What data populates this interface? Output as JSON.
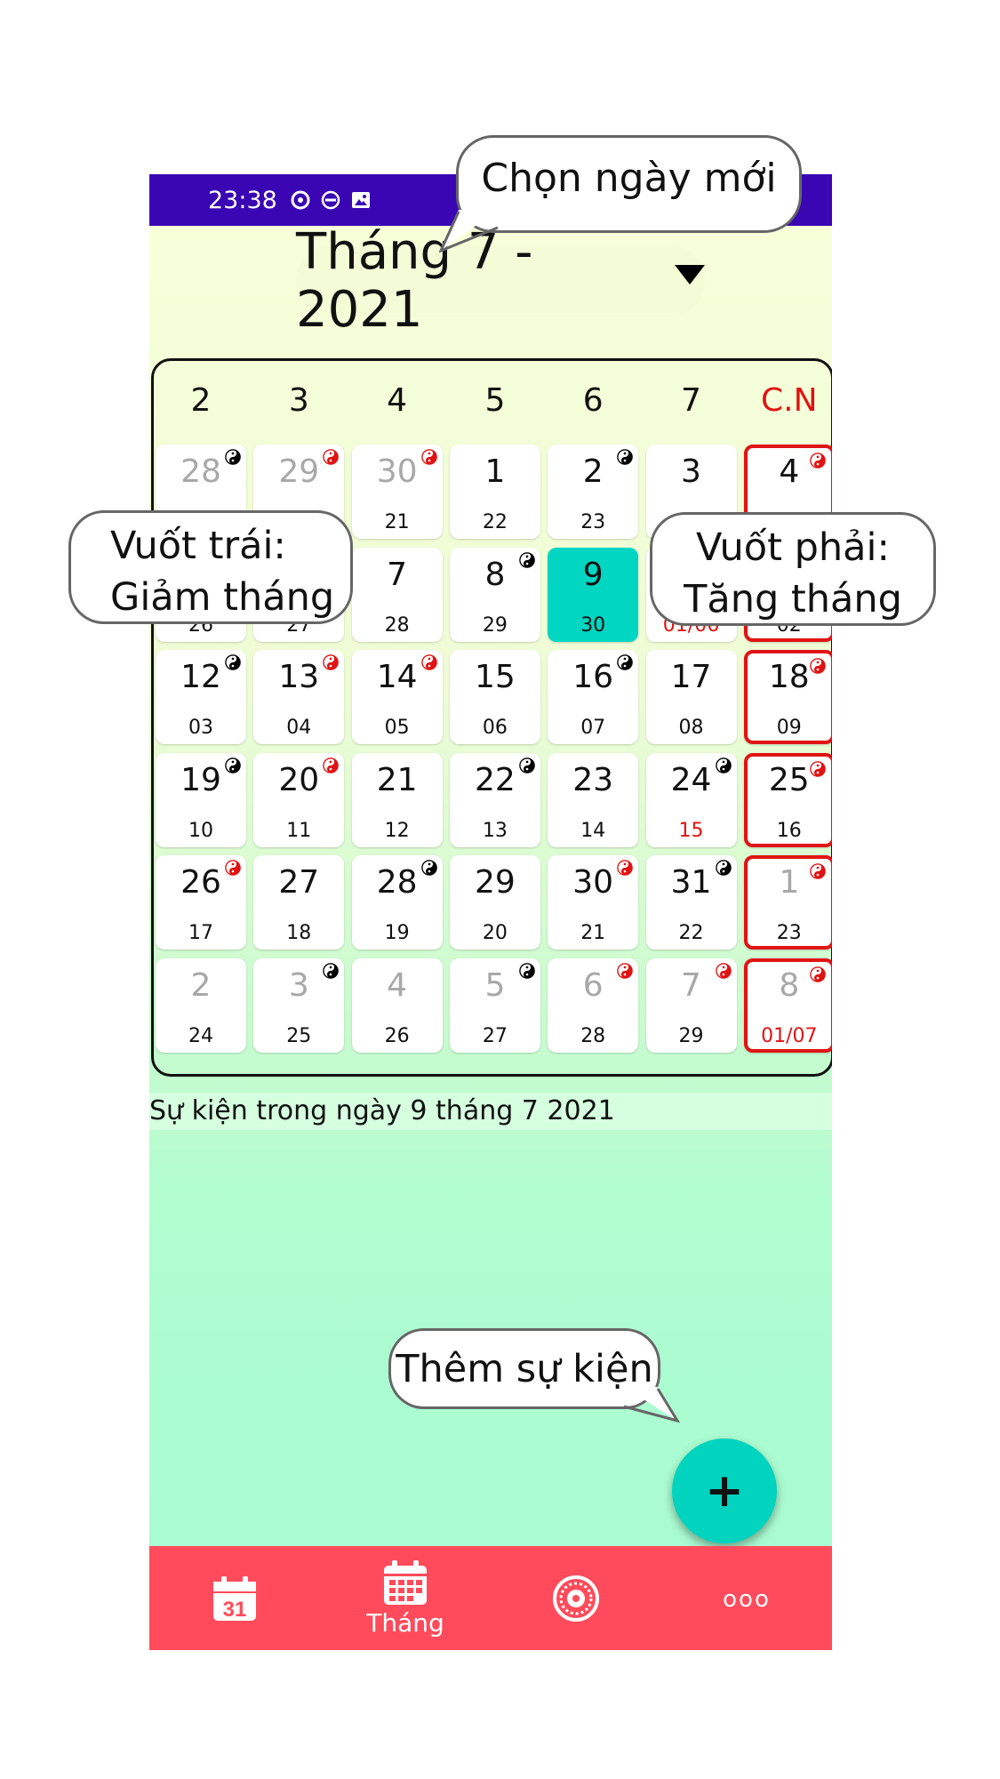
{
  "status_bar": {
    "time": "23:38"
  },
  "header": {
    "month_label": "Tháng 7 - 2021"
  },
  "weekdays": [
    "2",
    "3",
    "4",
    "5",
    "6",
    "7",
    "C.N"
  ],
  "weeks": [
    [
      {
        "d": "28",
        "l": "",
        "dim": true,
        "yy": "b"
      },
      {
        "d": "29",
        "l": "",
        "dim": true,
        "yy": "r"
      },
      {
        "d": "30",
        "l": "21",
        "dim": true,
        "yy": "r"
      },
      {
        "d": "1",
        "l": "22",
        "yy": ""
      },
      {
        "d": "2",
        "l": "23",
        "yy": "b"
      },
      {
        "d": "3",
        "l": "",
        "yy": ""
      },
      {
        "d": "4",
        "l": "",
        "yy": "r",
        "sun": true
      }
    ],
    [
      {
        "d": "",
        "l": "26",
        "yy": ""
      },
      {
        "d": "",
        "l": "27",
        "yy": ""
      },
      {
        "d": "7",
        "l": "28",
        "yy": ""
      },
      {
        "d": "8",
        "l": "29",
        "yy": "b"
      },
      {
        "d": "9",
        "l": "30",
        "yy": "",
        "selected": true
      },
      {
        "d": "",
        "l": "01/06",
        "yy": "",
        "lred": true
      },
      {
        "d": "",
        "l": "02",
        "yy": "",
        "sun": true
      }
    ],
    [
      {
        "d": "12",
        "l": "03",
        "yy": "b"
      },
      {
        "d": "13",
        "l": "04",
        "yy": "r"
      },
      {
        "d": "14",
        "l": "05",
        "yy": "r"
      },
      {
        "d": "15",
        "l": "06",
        "yy": ""
      },
      {
        "d": "16",
        "l": "07",
        "yy": "b"
      },
      {
        "d": "17",
        "l": "08",
        "yy": ""
      },
      {
        "d": "18",
        "l": "09",
        "yy": "r",
        "sun": true
      }
    ],
    [
      {
        "d": "19",
        "l": "10",
        "yy": "b"
      },
      {
        "d": "20",
        "l": "11",
        "yy": "r"
      },
      {
        "d": "21",
        "l": "12",
        "yy": ""
      },
      {
        "d": "22",
        "l": "13",
        "yy": "b"
      },
      {
        "d": "23",
        "l": "14",
        "yy": ""
      },
      {
        "d": "24",
        "l": "15",
        "yy": "b",
        "lred": true
      },
      {
        "d": "25",
        "l": "16",
        "yy": "r",
        "sun": true
      }
    ],
    [
      {
        "d": "26",
        "l": "17",
        "yy": "r"
      },
      {
        "d": "27",
        "l": "18",
        "yy": ""
      },
      {
        "d": "28",
        "l": "19",
        "yy": "b"
      },
      {
        "d": "29",
        "l": "20",
        "yy": ""
      },
      {
        "d": "30",
        "l": "21",
        "yy": "r"
      },
      {
        "d": "31",
        "l": "22",
        "yy": "b"
      },
      {
        "d": "1",
        "l": "23",
        "yy": "r",
        "sun": true,
        "dim": true
      }
    ],
    [
      {
        "d": "2",
        "l": "24",
        "dim": true,
        "yy": ""
      },
      {
        "d": "3",
        "l": "25",
        "dim": true,
        "yy": "b"
      },
      {
        "d": "4",
        "l": "26",
        "dim": true,
        "yy": ""
      },
      {
        "d": "5",
        "l": "27",
        "dim": true,
        "yy": "b"
      },
      {
        "d": "6",
        "l": "28",
        "dim": true,
        "yy": "r"
      },
      {
        "d": "7",
        "l": "29",
        "dim": true,
        "yy": "r"
      },
      {
        "d": "8",
        "l": "01/07",
        "dim": true,
        "yy": "r",
        "sun": true,
        "lred": true
      }
    ]
  ],
  "events": {
    "label": "Sự kiện trong ngày 9 tháng 7 2021"
  },
  "fab": {
    "symbol": "+"
  },
  "bottom_nav": {
    "day_icon_number": "31",
    "month_label": "Tháng",
    "more_symbol": "ooo"
  },
  "callouts": {
    "select_date": "Chọn ngày mới",
    "swipe_left_line1": "Vuốt trái:",
    "swipe_left_line2": "Giảm tháng",
    "swipe_right_line1": "Vuốt phải:",
    "swipe_right_line2": "Tăng tháng",
    "add_event": "Thêm sự kiện"
  },
  "colors": {
    "status_bar": "#3a06b3",
    "selected_day": "#00d6c1",
    "sunday_border": "#e01414",
    "bottom_bar": "#ff4b5b",
    "fab": "#00d3be"
  }
}
